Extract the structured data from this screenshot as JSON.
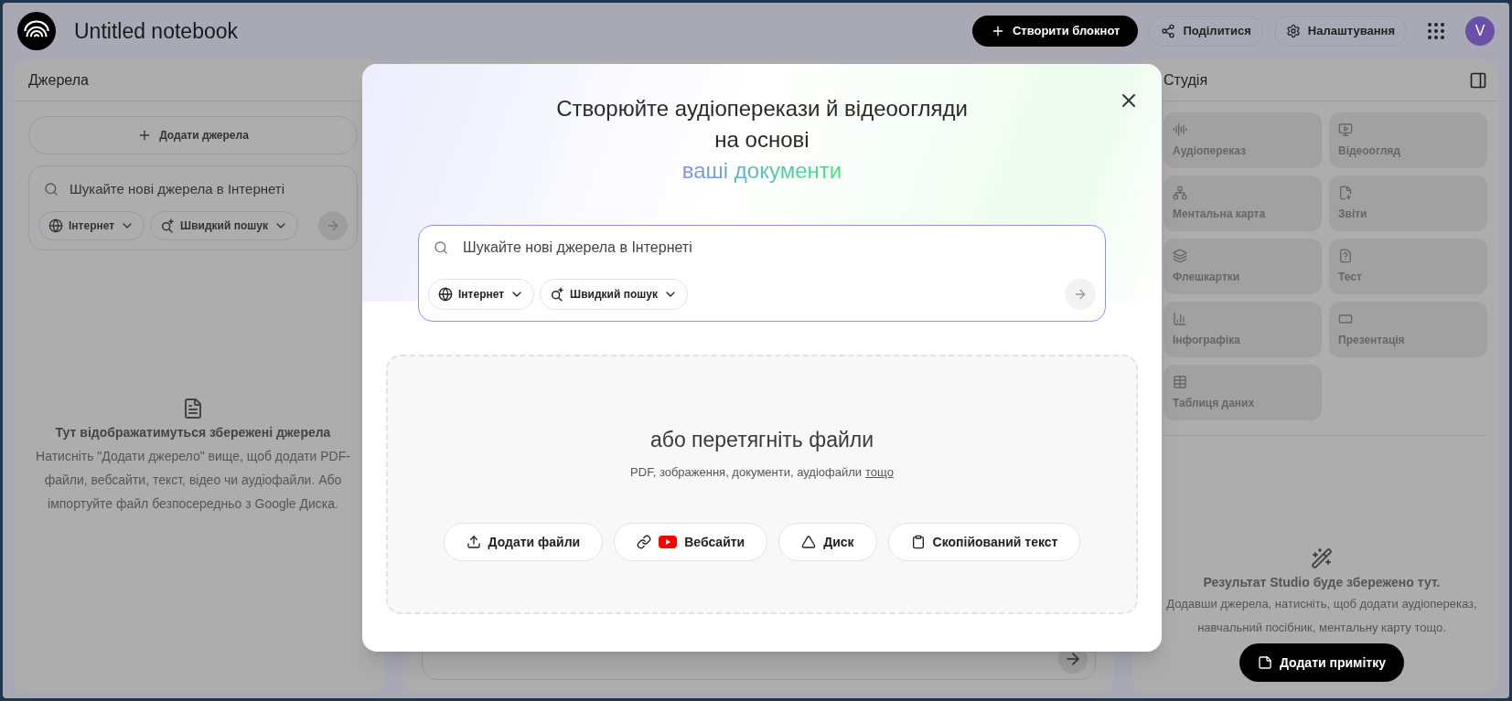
{
  "header": {
    "title": "Untitled notebook",
    "create_button": "Створити блокнот",
    "share_button": "Поділитися",
    "settings_button": "Налаштування",
    "avatar": "V"
  },
  "sources": {
    "title": "Джерела",
    "add_button": "Додати джерела",
    "search": {
      "placeholder": "Шукайте нові джерела в Інтернеті",
      "chips": [
        "Інтернет",
        "Швидкий пошук"
      ]
    },
    "empty_title": "Тут відображатимуться збережені джерела",
    "empty_text": "Натисніть \"Додати джерело\" вище, щоб додати PDF-файли, вебсайти, текст, відео чи аудіофайли. Або імпортуйте файл безпосередньо з Google Диска."
  },
  "studio": {
    "title": "Студія",
    "tools": [
      "Аудіопереказ",
      "Відеоогляд",
      "Ментальна карта",
      "Звіти",
      "Флешкартки",
      "Тест",
      "Інфографіка",
      "Презентація",
      "Таблиця даних"
    ],
    "empty_title": "Результат Studio буде збережено тут.",
    "empty_text": "Додавши джерела, натисніть, щоб додати аудіопереказ, навчальний посібник, ментальну карту тощо.",
    "note_button": "Додати примітку"
  },
  "modal": {
    "title_lines": [
      "Створюйте аудіоперекази й відеоогляди",
      "на основі"
    ],
    "highlight": "ваші документи",
    "search": {
      "placeholder": "Шукайте нові джерела в Інтернеті",
      "chips": [
        "Інтернет",
        "Швидкий пошук"
      ]
    },
    "drop_title": "або перетягніть файли",
    "drop_subtitle": "PDF, зображення, документи, аудіофайли",
    "drop_link": "тощо",
    "buttons": [
      "Додати файли",
      "Вебсайти",
      "Диск",
      "Скопійований текст"
    ]
  }
}
